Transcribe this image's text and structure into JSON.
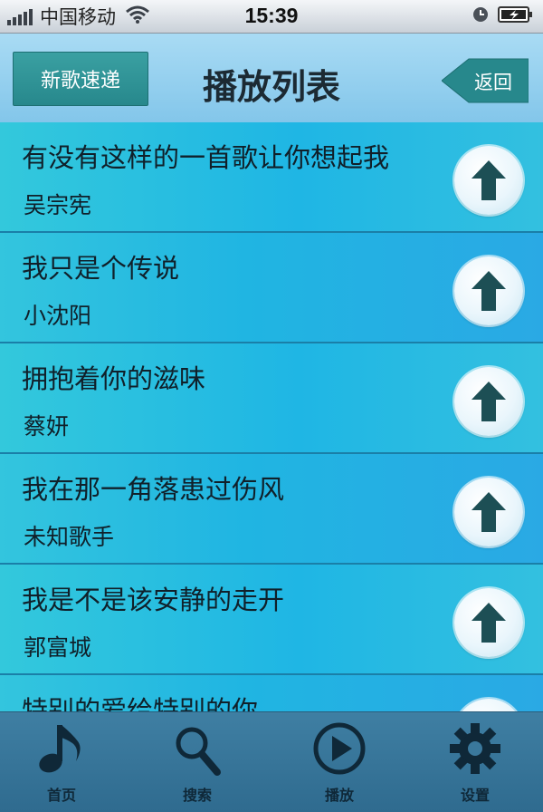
{
  "status_bar": {
    "carrier": "中国移动",
    "time": "15:39"
  },
  "header": {
    "left_button": "新歌速递",
    "title": "播放列表",
    "back_button": "返回"
  },
  "songs": [
    {
      "title": "有没有这样的一首歌让你想起我",
      "artist": "吴宗宪"
    },
    {
      "title": "我只是个传说",
      "artist": "小沈阳"
    },
    {
      "title": "拥抱着你的滋味",
      "artist": "蔡妍"
    },
    {
      "title": "我在那一角落患过伤风",
      "artist": "未知歌手"
    },
    {
      "title": "我是不是该安静的走开",
      "artist": "郭富城"
    },
    {
      "title": "特别的爱给特别的你",
      "artist": ""
    }
  ],
  "tabbar": {
    "home": "首页",
    "search": "搜索",
    "play": "播放",
    "settings": "设置"
  },
  "icons": [
    "signal-icon",
    "wifi-icon",
    "clock-icon",
    "battery-icon",
    "up-arrow-icon",
    "music-note-icon",
    "search-icon",
    "play-icon",
    "gear-icon"
  ]
}
